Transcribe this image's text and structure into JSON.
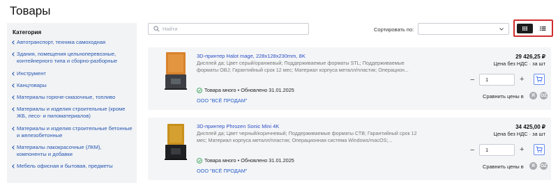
{
  "page_title": "Товары",
  "sidebar": {
    "heading": "Категория",
    "items": [
      {
        "label": "Автотранспорт, техника самоходная"
      },
      {
        "label": "Здания, помещения цельноперевозные, контейнерного типа и сборно-разборные"
      },
      {
        "label": "Инструмент"
      },
      {
        "label": "Канцтовары"
      },
      {
        "label": "Материалы горюче-смазочные, топливо"
      },
      {
        "label": "Материалы и изделия строительные (кроме ЖБ, лесо- и пиломатериалов)"
      },
      {
        "label": "Материалы и изделия строительные бетонные и железобетонные"
      },
      {
        "label": "Материалы лакокрасочные (ЛКМ), компоненты и добавки"
      },
      {
        "label": "Мебель офисная и бытовая, предметы"
      }
    ]
  },
  "toolbar": {
    "search_placeholder": "Найти",
    "search_value": "",
    "sort_label": "Сортировать по:",
    "sort_value": "",
    "view_selected": "grid"
  },
  "products": [
    {
      "name": "3D-принтер Halot mage, 228х128х230mm, 8K",
      "description": "Дисплей да; Цвет серый/оранжевый; Поддерживаемые форматы STL; Поддерживаемые форматы OBJ; Гарантийный срок 12 мес; Материал корпуса металл/пластик; Операцион...",
      "stock": "Товара много • Обновлено 31.01.2025",
      "seller": "ООО \"ВСЁ ПРОДАМ\"",
      "price": "29 426,25 ₽",
      "price_note": "Цена без НДС · за шт",
      "quantity": "1",
      "minus": "−",
      "plus": "+",
      "compare_label": "Сравнить цены в",
      "compare_icons": [
        "Я",
        "OZ"
      ],
      "image_color": "#d9822b"
    },
    {
      "name": "3D-принтер Phrozen Sonic Mini 4K",
      "description": "Дисплей да; Цвет черный/коричневый; Поддерживаемые форматы СТВ; Гарантийный срок 12 мес; Материал корпуса металл/пластик; Операционная система Windows/macOS;...",
      "stock": "Товара много • Обновлено 31.01.2025",
      "seller": "ООО \"ВСЁ ПРОДАМ\"",
      "price": "34 425,00 ₽",
      "price_note": "Цена без НДС · за шт",
      "quantity": "1",
      "minus": "−",
      "plus": "+",
      "compare_label": "Сравнить цены в",
      "compare_icons": [
        "Я",
        "OZ"
      ],
      "image_color": "#c8901c"
    }
  ],
  "colors": {
    "accent_link": "#2a4ec4",
    "highlight_border": "#d02d2d",
    "in_stock": "#2e9e4f"
  }
}
